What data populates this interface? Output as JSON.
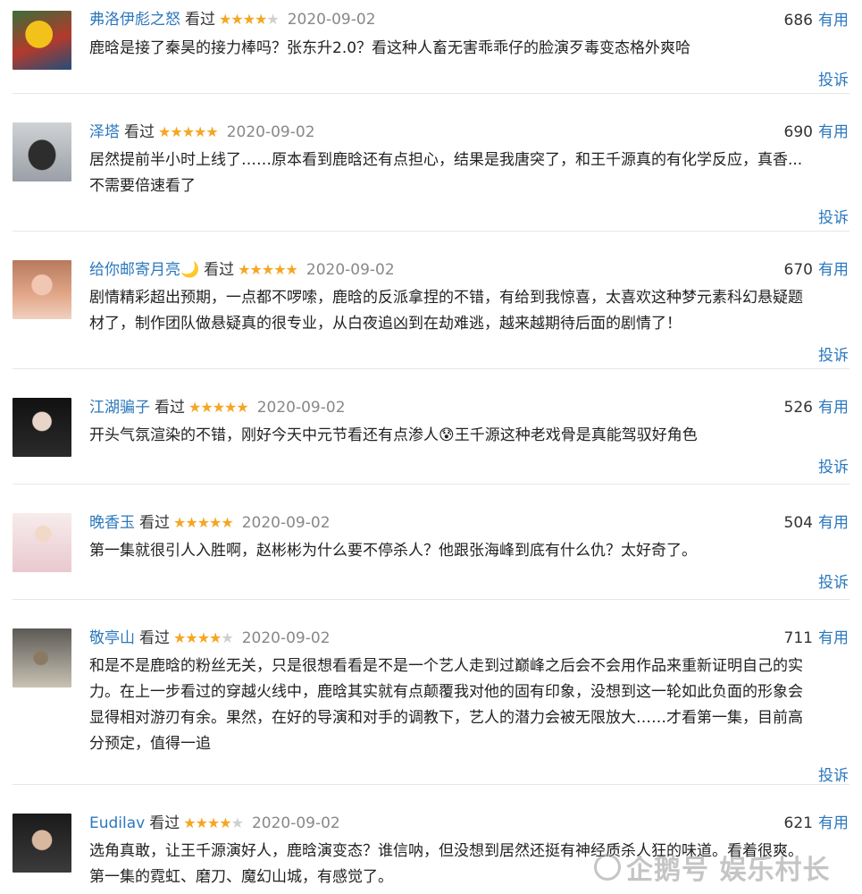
{
  "ui": {
    "status_label": "看过",
    "useful_label": "有用",
    "report_label": "投诉",
    "star_glyph": "★",
    "colors": {
      "link": "#2b78bd",
      "star_on": "#f5a623",
      "star_off": "#cfcfcf",
      "date": "#888888"
    }
  },
  "comments": [
    {
      "user": "弗洛伊彪之怒",
      "stars": 4,
      "date": "2020-09-02",
      "votes": "686",
      "avatar_icon": "yellow-cartoon-avatar",
      "lines": [
        "鹿晗是接了秦昊的接力棒吗？张东升2.0？看这种人畜无害乖乖仔的脸演歹毒变态格外爽哈"
      ]
    },
    {
      "user": "泽塔",
      "stars": 5,
      "date": "2020-09-02",
      "votes": "690",
      "avatar_icon": "gray-cat-avatar",
      "lines": [
        "居然提前半小时上线了……原本看到鹿晗还有点担心，结果是我唐突了，和王千源真的有化学反应，真香...",
        "不需要倍速看了"
      ]
    },
    {
      "user": "给你邮寄月亮🌙",
      "stars": 5,
      "date": "2020-09-02",
      "votes": "670",
      "avatar_icon": "girl-portrait-avatar",
      "lines": [
        "剧情精彩超出预期，一点都不啰嗦，鹿晗的反派拿捏的不错，有给到我惊喜，太喜欢这种梦元素科幻悬疑题",
        "材了，制作团队做悬疑真的很专业，从白夜追凶到在劫难逃，越来越期待后面的剧情了！"
      ]
    },
    {
      "user": "江湖骗子",
      "stars": 5,
      "date": "2020-09-02",
      "votes": "526",
      "avatar_icon": "dark-portrait-avatar",
      "lines": [
        "开头气氛渲染的不错，刚好今天中元节看还有点渗人😰王千源这种老戏骨是真能驾驭好角色"
      ]
    },
    {
      "user": "晚香玉",
      "stars": 5,
      "date": "2020-09-02",
      "votes": "504",
      "avatar_icon": "blonde-woman-avatar",
      "lines": [
        "第一集就很引人入胜啊，赵彬彬为什么要不停杀人？他跟张海峰到底有什么仇？太好奇了。"
      ]
    },
    {
      "user": "敬亭山",
      "stars": 4,
      "date": "2020-09-02",
      "votes": "711",
      "avatar_icon": "statue-avatar",
      "lines": [
        "和是不是鹿晗的粉丝无关，只是很想看看是不是一个艺人走到过巅峰之后会不会用作品来重新证明自己的实",
        "力。在上一步看过的穿越火线中，鹿晗其实就有点颠覆我对他的固有印象，没想到这一轮如此负面的形象会",
        "显得相对游刃有余。果然，在好的导演和对手的调教下，艺人的潜力会被无限放大……才看第一集，目前高",
        "分预定，值得一追"
      ]
    },
    {
      "user": "Eudilav",
      "stars": 4,
      "date": "2020-09-02",
      "votes": "621",
      "avatar_icon": "boy-photo-avatar",
      "lines": [
        "选角真敢，让王千源演好人，鹿晗演变态？谁信呐，但没想到居然还挺有神经质杀人狂的味道。看着很爽。",
        "第一集的霓虹、磨刀、魔幻山城，有感觉了。"
      ]
    }
  ],
  "watermark": {
    "text": "企鹅号 娱乐村长",
    "icon": "penguin-logo-icon"
  }
}
